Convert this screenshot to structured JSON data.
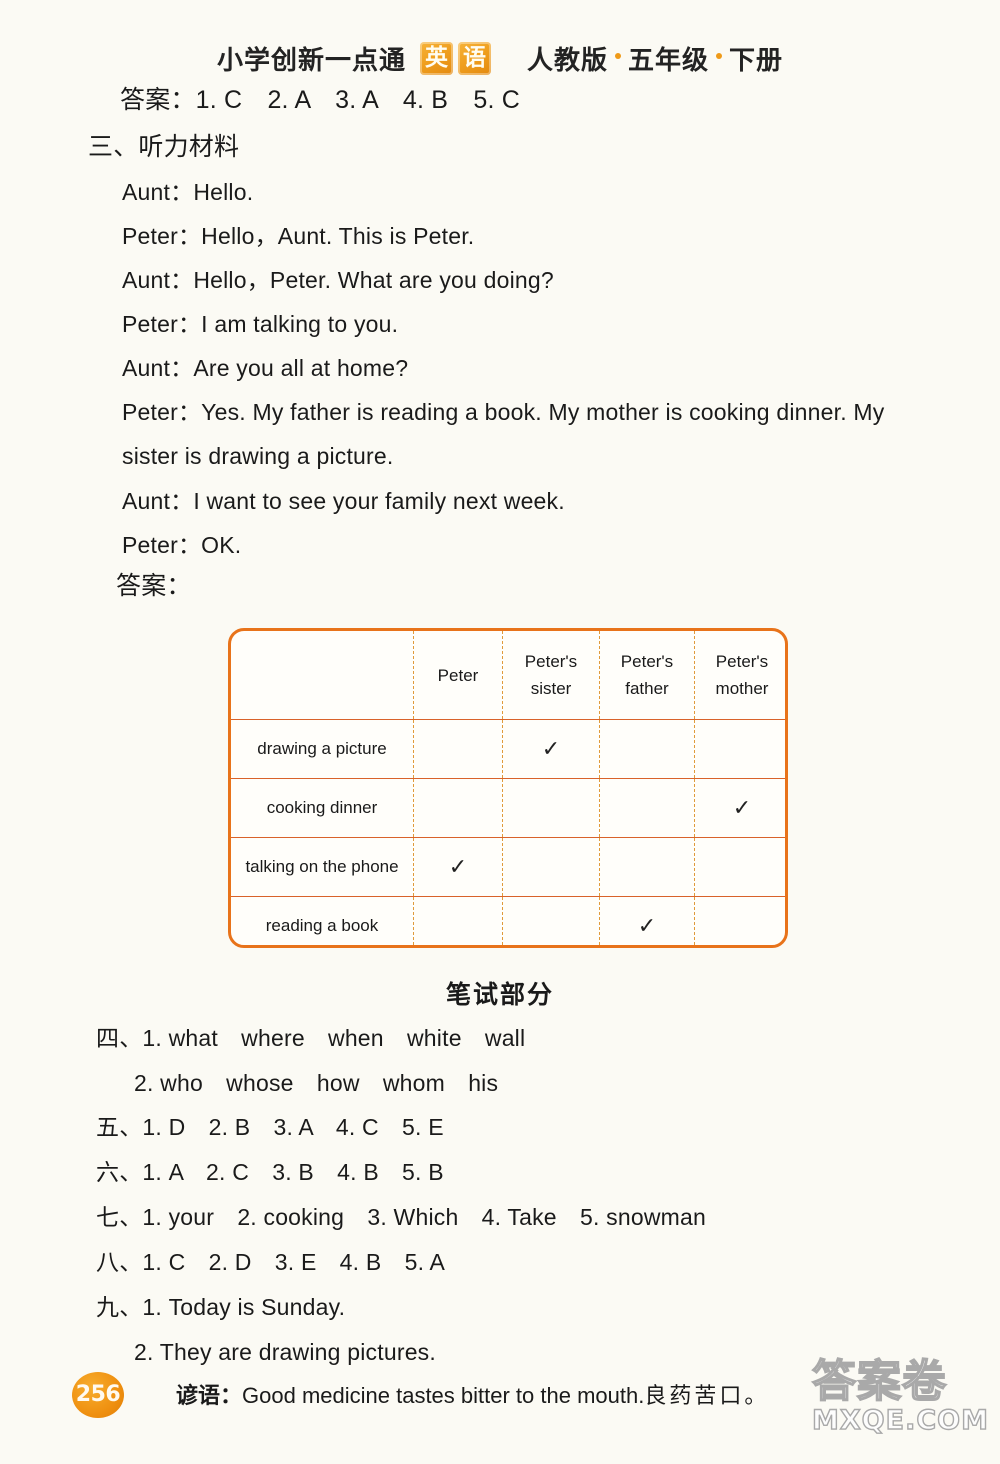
{
  "header": {
    "book_title": "小学创新一点通",
    "subject_logo": [
      "英",
      "语"
    ],
    "edition": "人教版",
    "grade": "五年级",
    "volume": "下册",
    "accent_color": "#ef9a18"
  },
  "answers_top": {
    "label": "答案：",
    "items": "1. C　2. A　3. A　4. B　5. C",
    "full_line": "答案：1. C　2. A　3. A　4. B　5. C"
  },
  "listening": {
    "section_title": "三、听力材料",
    "dialogue": [
      "Aunt：Hello.",
      "Peter：Hello，Aunt. This is Peter.",
      "Aunt：Hello，Peter. What are you doing?",
      "Peter：I am talking to you.",
      "Aunt：Are you all at home?",
      "Peter：Yes. My father is reading a book. My mother is cooking dinner. My",
      "sister is drawing a picture.",
      "Aunt：I want to see your family next week.",
      "Peter：OK."
    ],
    "answer_label": "答案："
  },
  "table": {
    "border_color": "#e8731a",
    "columns": [
      "",
      "Peter",
      "Peter's sister",
      "Peter's father",
      "Peter's mother"
    ],
    "column_lines": [
      [
        "",
        ""
      ],
      [
        "Peter",
        ""
      ],
      [
        "Peter's",
        "sister"
      ],
      [
        "Peter's",
        "father"
      ],
      [
        "Peter's",
        "mother"
      ]
    ],
    "check_mark": "✓",
    "rows": [
      {
        "activity": "drawing a picture",
        "marks": [
          false,
          true,
          false,
          false
        ]
      },
      {
        "activity": "cooking dinner",
        "marks": [
          false,
          false,
          false,
          true
        ]
      },
      {
        "activity": "talking on the phone",
        "marks": [
          true,
          false,
          false,
          false
        ]
      },
      {
        "activity": "reading a book",
        "marks": [
          false,
          false,
          true,
          false
        ]
      }
    ]
  },
  "written_exam": {
    "banner": "笔试部分",
    "sections": [
      {
        "num": "四、",
        "line1": "1. what　where　when　white　wall",
        "line2": "2. who　whose　how　whom　his"
      },
      {
        "num": "五、",
        "line1": "1. D　2. B　3. A　4. C　5. E"
      },
      {
        "num": "六、",
        "line1": "1. A　2. C　3. B　4. B　5. B"
      },
      {
        "num": "七、",
        "line1": "1. your　2. cooking　3. Which　4. Take　5. snowman"
      },
      {
        "num": "八、",
        "line1": "1. C　2. D　3. E　4. B　5. A"
      },
      {
        "num": "九、",
        "line1": "1. Today is Sunday.",
        "line2": "2. They are drawing pictures."
      }
    ]
  },
  "footer": {
    "page_number": "256",
    "proverb_label": "谚语：",
    "proverb_en": "Good medicine tastes bitter to the mouth.",
    "proverb_cn": "良药苦口。",
    "watermark_top": "答案卷",
    "watermark_bottom": "MXQE.COM"
  }
}
